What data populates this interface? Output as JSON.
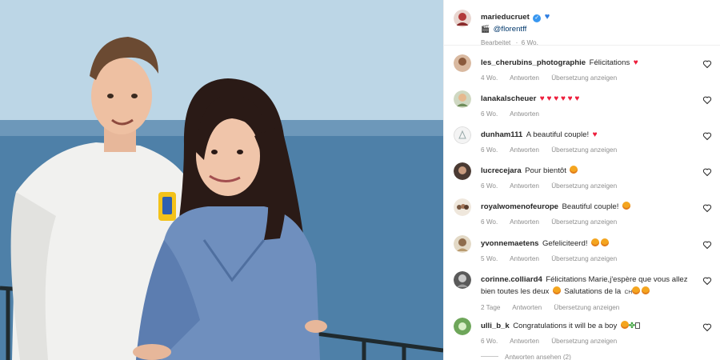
{
  "post": {
    "author": "marieducruet",
    "caption_icon": "clapperboard-emoji",
    "mention": "@florentff",
    "edited": "Bearbeitet",
    "age": "6 Wo."
  },
  "actions": {
    "reply": "Antworten",
    "translate": "Übersetzung anzeigen"
  },
  "comments": [
    {
      "user": "les_cherubins_photographie",
      "text": "Félicitations",
      "age": "4 Wo."
    },
    {
      "user": "lanakalscheuer",
      "text": "",
      "age": "6 Wo."
    },
    {
      "user": "dunham111",
      "text": "A beautiful couple!",
      "age": "6 Wo."
    },
    {
      "user": "lucrecejara",
      "text": "Pour bientôt",
      "age": "6 Wo."
    },
    {
      "user": "royalwomenofeurope",
      "text": "Beautiful couple!",
      "age": "6 Wo."
    },
    {
      "user": "yvonnemaetens",
      "text": "Gefeliciteerd!",
      "age": "5 Wo."
    },
    {
      "user": "corinne.colliard4",
      "text": "Félicitations Marie,j'espère que vous allez bien toutes les deux",
      "text2": "Salutations de la",
      "text3": "CH",
      "age": "2 Tage"
    },
    {
      "user": "ulli_b_k",
      "text": "Congratulations it will be a boy",
      "age": "6 Wo."
    }
  ],
  "view_replies": "Antworten ansehen (2)",
  "colors": {
    "heart": "#ed1c3a",
    "verified": "#3897f0",
    "meta": "#8e8e8e"
  }
}
